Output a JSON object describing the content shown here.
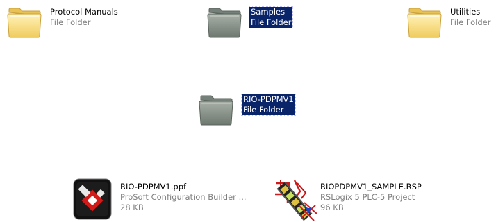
{
  "items": {
    "protocol_manuals": {
      "name": "Protocol Manuals",
      "type": "File Folder",
      "icon": "folder-icon",
      "selected": false
    },
    "samples": {
      "name": "Samples",
      "type": "File Folder",
      "icon": "folder-icon",
      "selected": true
    },
    "utilities": {
      "name": "Utilities",
      "type": "File Folder",
      "icon": "folder-icon",
      "selected": false
    },
    "rio_pdpmv1": {
      "name": "RIO-PDPMV1",
      "type": "File Folder",
      "icon": "folder-icon",
      "selected": true
    },
    "ppf_file": {
      "name": "RIO-PDPMV1.ppf",
      "type": "ProSoft Configuration Builder ...",
      "size": "28 KB",
      "icon": "prosoft-config-file-icon"
    },
    "rsp_file": {
      "name": "RIOPDPMV1_SAMPLE.RSP",
      "type": "RSLogix 5 PLC-5 Project",
      "size": "96 KB",
      "icon": "rslogix-project-icon"
    }
  },
  "colors": {
    "selection_bg": "#0a246a",
    "folder_yellow": "#f5d77a",
    "folder_gray": "#7f8a7f",
    "secondary_text": "#7f7f7f"
  }
}
